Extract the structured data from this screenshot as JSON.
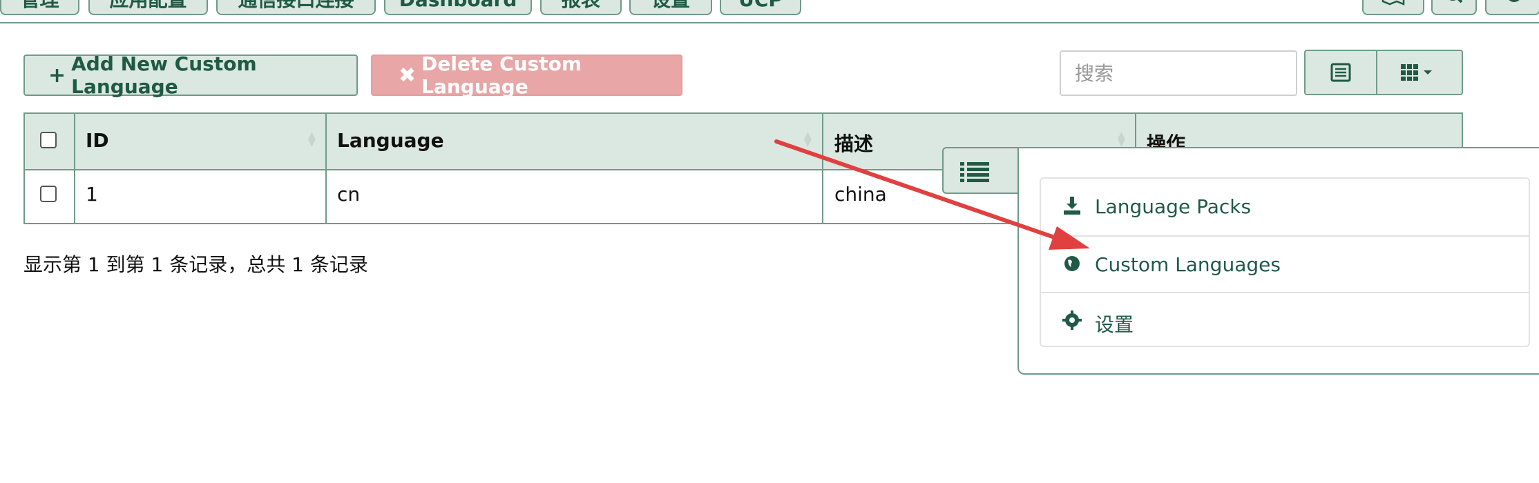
{
  "nav": {
    "tabs": [
      "管理",
      "应用配置",
      "通信接口连接",
      "Dashboard",
      "报表",
      "设置",
      "UCP"
    ],
    "icons": [
      "map-icon",
      "search-icon",
      "gear-icon"
    ]
  },
  "toolbar": {
    "add_label": "Add New Custom Language",
    "delete_label": "Delete Custom Language",
    "search_placeholder": "搜索",
    "view_list_icon": "list-view-icon",
    "columns_icon": "grid-columns-icon"
  },
  "table": {
    "headers": [
      "ID",
      "Language",
      "描述",
      "操作"
    ],
    "rows": [
      {
        "id": "1",
        "language": "cn",
        "description": "china"
      }
    ]
  },
  "footer": {
    "summary": "显示第 1 到第 1 条记录，总共 1 条记录"
  },
  "menu": {
    "toggle_icon": "list-icon",
    "items": [
      {
        "label": "Language Packs",
        "icon": "download-icon"
      },
      {
        "label": "Custom Languages",
        "icon": "globe-icon"
      },
      {
        "label": "设置",
        "icon": "gear-icon"
      }
    ]
  },
  "colors": {
    "accent": "#1f5a45",
    "header_bg": "#dbe7e1",
    "border": "#6f9a88",
    "danger": "#e8a6a6",
    "annotation_arrow": "#e04040"
  }
}
